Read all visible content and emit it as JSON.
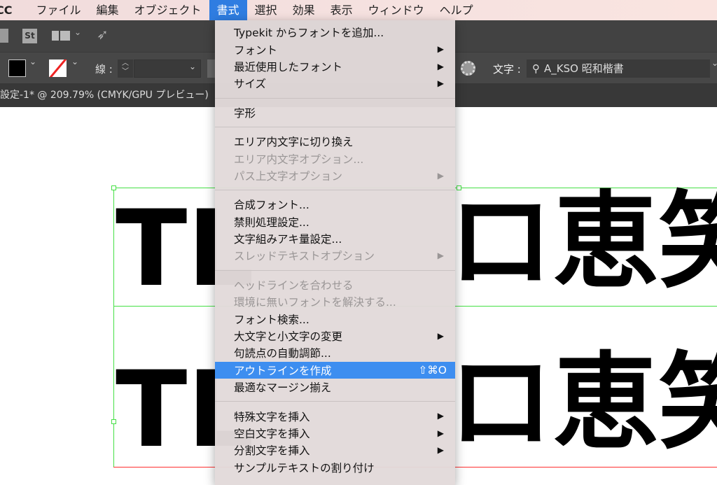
{
  "menubar": {
    "app": "CC",
    "items": [
      "ファイル",
      "編集",
      "オブジェクト",
      "書式",
      "選択",
      "効果",
      "表示",
      "ウィンドウ",
      "ヘルプ"
    ],
    "active": "書式"
  },
  "toolbar": {
    "st_label": "St",
    "stroke_label": "線 :",
    "char_label": "文字 :",
    "font_value": "A_KSO 昭和楷書"
  },
  "document_tab": "設定-1* @ 209.79% (CMYK/GPU プレビュー)",
  "canvas": {
    "text_left": "TL",
    "text_right": "ロ恵笑"
  },
  "menu": {
    "groups": [
      [
        {
          "label": "Typekit からフォントを追加..."
        },
        {
          "label": "フォント",
          "submenu": true
        },
        {
          "label": "最近使用したフォント",
          "submenu": true
        },
        {
          "label": "サイズ",
          "submenu": true
        }
      ],
      [
        {
          "label": "字形"
        }
      ],
      [
        {
          "label": "エリア内文字に切り換え"
        },
        {
          "label": "エリア内文字オプション...",
          "disabled": true
        },
        {
          "label": "パス上文字オプション",
          "submenu": true,
          "disabled": true
        }
      ],
      [
        {
          "label": "合成フォント..."
        },
        {
          "label": "禁則処理設定..."
        },
        {
          "label": "文字組みアキ量設定..."
        },
        {
          "label": "スレッドテキストオプション",
          "submenu": true,
          "disabled": true
        }
      ],
      [
        {
          "label": "ヘッドラインを合わせる",
          "disabled": true
        },
        {
          "label": "環境に無いフォントを解決する...",
          "disabled": true
        },
        {
          "label": "フォント検索..."
        },
        {
          "label": "大文字と小文字の変更",
          "submenu": true
        },
        {
          "label": "句読点の自動調節..."
        },
        {
          "label": "アウトラインを作成",
          "shortcut": "⇧⌘O",
          "highlighted": true
        },
        {
          "label": "最適なマージン揃え"
        }
      ],
      [
        {
          "label": "特殊文字を挿入",
          "submenu": true
        },
        {
          "label": "空白文字を挿入",
          "submenu": true
        },
        {
          "label": "分割文字を挿入",
          "submenu": true
        },
        {
          "label": "サンプルテキストの割り付け"
        }
      ]
    ]
  },
  "colors": {
    "accent": "#3d8ef0",
    "menubar_active": "#2f7de1",
    "selection": "#45e045",
    "baseline": "#ff3030"
  }
}
